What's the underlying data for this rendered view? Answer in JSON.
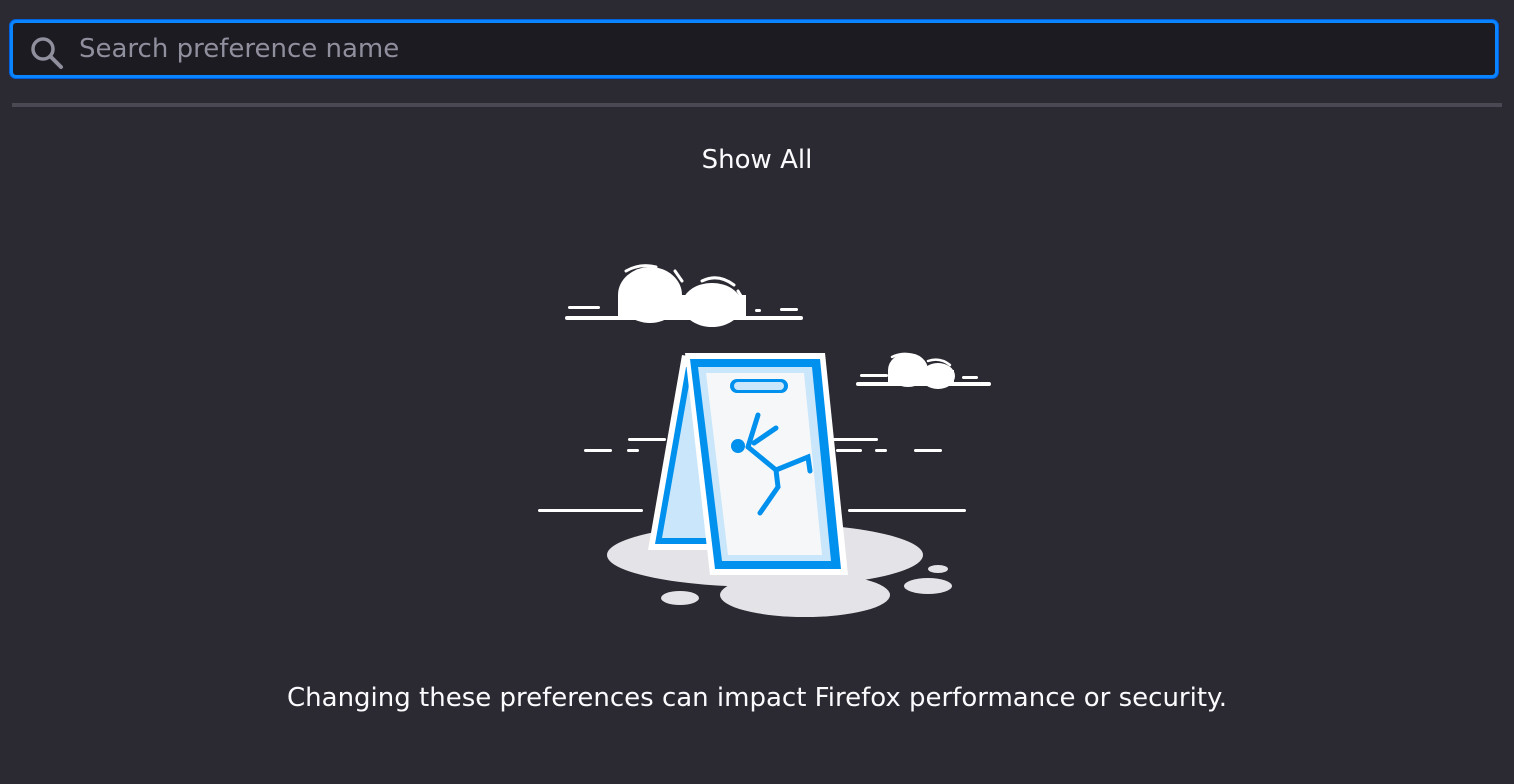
{
  "search": {
    "placeholder": "Search preference name",
    "value": "",
    "icon": "search-icon"
  },
  "show_all_label": "Show All",
  "illustration": {
    "name": "caution-sign-illustration",
    "accent_color": "#0090ed"
  },
  "warning_text": "Changing these preferences can impact Firefox performance or security.",
  "colors": {
    "background": "#2b2a33",
    "focus_ring": "#0a84ff",
    "text": "#fbfbfe"
  }
}
